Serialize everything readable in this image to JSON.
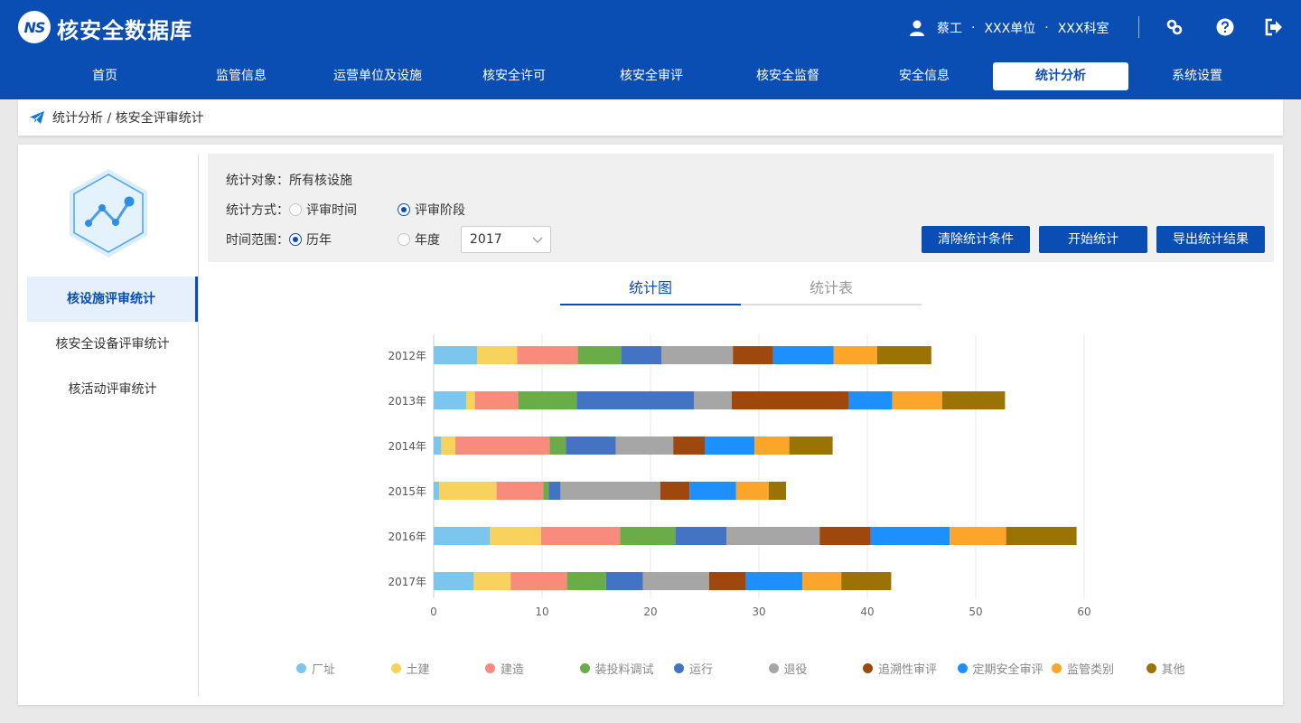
{
  "header": {
    "logo_text": "NS",
    "app_title": "核安全数据库",
    "user_name": "蔡工",
    "user_org": "XXX单位",
    "user_dept": "XXX科室",
    "sep": "·",
    "icons": [
      "user-icon",
      "link-icon",
      "help-icon",
      "logout-icon"
    ]
  },
  "nav": {
    "items": [
      "首页",
      "监管信息",
      "运营单位及设施",
      "核安全许可",
      "核安全审评",
      "核安全监督",
      "安全信息",
      "统计分析",
      "系统设置"
    ],
    "active": "统计分析"
  },
  "breadcrumb": {
    "text": "统计分析 / 核安全评审统计",
    "icon": "paper-plane-icon"
  },
  "sidebar": {
    "emblem": "line-chart-hexagon-icon",
    "items": [
      "核设施评审统计",
      "核安全设备评审统计",
      "核活动评审统计"
    ],
    "active": "核设施评审统计"
  },
  "filters": {
    "target_label": "统计对象：",
    "target_value": "所有核设施",
    "method_label": "统计方式：",
    "method_options": [
      "评审时间",
      "评审阶段"
    ],
    "method_selected": "评审阶段",
    "range_label": "时间范围：",
    "range_options": [
      "历年",
      "年度"
    ],
    "range_selected": "历年",
    "year_value": "2017",
    "buttons": {
      "clear": "清除统计条件",
      "start": "开始统计",
      "export": "导出统计结果"
    }
  },
  "tabs": {
    "items": [
      "统计图",
      "统计表"
    ],
    "active": "统计图"
  },
  "colors": {
    "primary": "#0a4eb4",
    "series": [
      "#7cc6ee",
      "#f7d25c",
      "#f98b7d",
      "#6aac47",
      "#4573c4",
      "#a6a6a6",
      "#9e480e",
      "#1e90fe",
      "#fba52b",
      "#9a7304"
    ]
  },
  "chart_data": {
    "type": "bar",
    "orientation": "horizontal",
    "stacked": true,
    "categories": [
      "2012年",
      "2013年",
      "2014年",
      "2015年",
      "2016年",
      "2017年"
    ],
    "series": [
      {
        "name": "厂址",
        "values": [
          4,
          3,
          0.7,
          0.5,
          5.2,
          3.7
        ]
      },
      {
        "name": "土建",
        "values": [
          3.7,
          0.8,
          1.3,
          5.3,
          4.7,
          3.4
        ]
      },
      {
        "name": "建造",
        "values": [
          5.6,
          4,
          8.7,
          4.3,
          7.3,
          5.2
        ]
      },
      {
        "name": "装投料调试",
        "values": [
          4,
          5.4,
          1.5,
          0.5,
          5.1,
          3.6
        ]
      },
      {
        "name": "运行",
        "values": [
          3.7,
          10.8,
          4.6,
          1.1,
          4.7,
          3.4
        ]
      },
      {
        "name": "退役",
        "values": [
          6.6,
          3.5,
          5.3,
          9.2,
          8.6,
          6.1
        ]
      },
      {
        "name": "追溯性审评",
        "values": [
          3.7,
          10.8,
          2.9,
          2.7,
          4.7,
          3.4
        ]
      },
      {
        "name": "定期安全审评",
        "values": [
          5.6,
          4,
          4.6,
          4.3,
          7.3,
          5.2
        ]
      },
      {
        "name": "监管类别",
        "values": [
          4,
          4.6,
          3.2,
          3,
          5.2,
          3.6
        ]
      },
      {
        "name": "其他",
        "values": [
          5,
          5.8,
          4,
          1.6,
          6.5,
          4.6
        ]
      }
    ],
    "xlim": [
      0,
      60
    ],
    "xticks": [
      0,
      10,
      20,
      30,
      40,
      50,
      60
    ],
    "grid": true,
    "legend_position": "bottom"
  }
}
